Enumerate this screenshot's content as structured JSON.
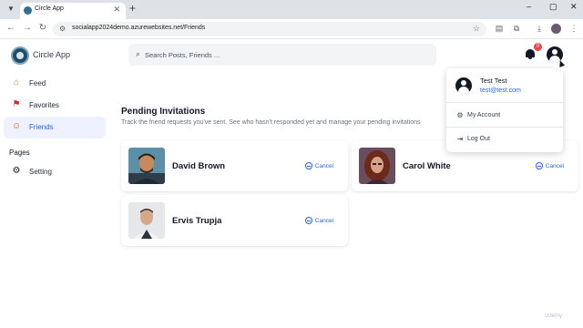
{
  "browser": {
    "tab_title": "Circle App",
    "tab_close": "✕",
    "new_tab": "+",
    "url": "socialapp2024demo.azurewebsites.net/Friends",
    "window_controls": [
      "–",
      "▢",
      "✕"
    ],
    "toolbar_icons": [
      "back-icon",
      "forward-icon",
      "reload-icon",
      "site-info-icon",
      "bookmark-star-icon",
      "reading-mode-icon",
      "extensions-icon",
      "download-icon",
      "profile-icon",
      "menu-icon"
    ]
  },
  "header": {
    "app_name": "Circle App",
    "search_placeholder": "Search Posts, Friends ...",
    "notification_count": "0"
  },
  "sidebar": {
    "items": [
      {
        "label": "Feed",
        "icon": "home-icon"
      },
      {
        "label": "Favorites",
        "icon": "favorites-icon"
      },
      {
        "label": "Friends",
        "icon": "friends-icon",
        "active": true
      }
    ],
    "section_title": "Pages",
    "page_items": [
      {
        "label": "Setting",
        "icon": "gear-icon"
      }
    ]
  },
  "main": {
    "title": "Pending Invitations",
    "subtitle": "Track the friend requests you've sent. See who hasn't responded yet and manage your pending invitations",
    "cancel_label": "Cancel",
    "invitations": [
      {
        "name": "David Brown"
      },
      {
        "name": "Carol White"
      },
      {
        "name": "Ervis Trupja"
      }
    ]
  },
  "user_menu": {
    "name": "Test Test",
    "email": "test@test.com",
    "items": [
      {
        "label": "My Account",
        "icon": "gear-icon"
      },
      {
        "label": "Log Out",
        "icon": "logout-icon"
      }
    ]
  },
  "watermark": "Udemy",
  "colors": {
    "accent": "#2563eb",
    "badge": "#ef4444",
    "active_bg": "#eef2ff"
  }
}
